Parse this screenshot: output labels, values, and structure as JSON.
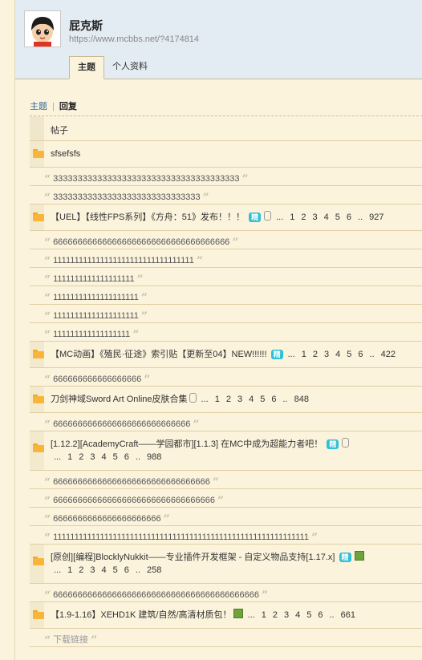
{
  "user": {
    "name": "屁克斯",
    "url": "https://www.mcbbs.net/?4174814"
  },
  "tabs": [
    {
      "label": "主题",
      "active": true
    },
    {
      "label": "个人资料",
      "active": false
    }
  ],
  "subnav": {
    "threads": "主题",
    "separator": "|",
    "replies": "回复"
  },
  "table_header": "帖子",
  "rows": [
    {
      "type": "thread",
      "title": "sfsefsfs"
    },
    {
      "type": "quote",
      "text": "33333333333333333333333333333333333333"
    },
    {
      "type": "quote",
      "text": "333333333333333333333333333333"
    },
    {
      "type": "thread",
      "title": "【UEL】【线性FPS系列】《方舟：51》发布！！！",
      "jing": "精",
      "attach": "clip",
      "pages": [
        "1",
        "2",
        "3",
        "4",
        "5",
        "6"
      ],
      "last": "927"
    },
    {
      "type": "quote",
      "text": "666666666666666666666666666666666666"
    },
    {
      "type": "quote",
      "text": "111111111111111111111111111111111"
    },
    {
      "type": "quote",
      "text": "1111111111111111111"
    },
    {
      "type": "quote",
      "text": "11111111111111111111"
    },
    {
      "type": "quote",
      "text": "11111111111111111111"
    },
    {
      "type": "quote",
      "text": "111111111111111111"
    },
    {
      "type": "thread",
      "title": "【MC动画】《殖民·征途》索引贴【更新至04】NEW!!!!!!",
      "jing": "精",
      "pages": [
        "1",
        "2",
        "3",
        "4",
        "5",
        "6"
      ],
      "last": "422"
    },
    {
      "type": "quote",
      "text": "666666666666666666"
    },
    {
      "type": "thread",
      "title": "刀剑神域Sword Art Online皮肤合集",
      "attach": "clip",
      "pages": [
        "1",
        "2",
        "3",
        "4",
        "5",
        "6"
      ],
      "last": "848"
    },
    {
      "type": "quote",
      "text": "6666666666666666666666666666"
    },
    {
      "type": "thread",
      "title": "[1.12.2][AcademyCraft——学园都市][1.1.3] 在MC中成为超能力者吧！",
      "jing": "精",
      "attach": "clip",
      "pages": [
        "1",
        "2",
        "3",
        "4",
        "5",
        "6"
      ],
      "last": "988",
      "tall": true
    },
    {
      "type": "quote",
      "text": "66666666666666666666666666666666"
    },
    {
      "type": "quote",
      "text": "666666666666666666666666666666666"
    },
    {
      "type": "quote",
      "text": "6666666666666666666666"
    },
    {
      "type": "quote",
      "text": "111111111111111111111111111111111111111111111111111111111111"
    },
    {
      "type": "thread",
      "title": "[原创][编程]BlocklyNukkit——专业插件开发框架 - 自定义物品支持[1.17.x]",
      "jing": "精",
      "attach": "image",
      "pages": [
        "1",
        "2",
        "3",
        "4",
        "5",
        "6"
      ],
      "last": "258",
      "tall": true
    },
    {
      "type": "quote",
      "text": "666666666666666666666666666666666666666666"
    },
    {
      "type": "thread",
      "title": "【1.9-1.16】XEHD1K 建筑/自然/高清材质包！",
      "attach": "image",
      "pages": [
        "1",
        "2",
        "3",
        "4",
        "5",
        "6"
      ],
      "last": "661"
    },
    {
      "type": "quote",
      "text": "下载链接",
      "gray": true
    }
  ],
  "labels": {
    "ellipsis": "...",
    "dots": ".."
  }
}
